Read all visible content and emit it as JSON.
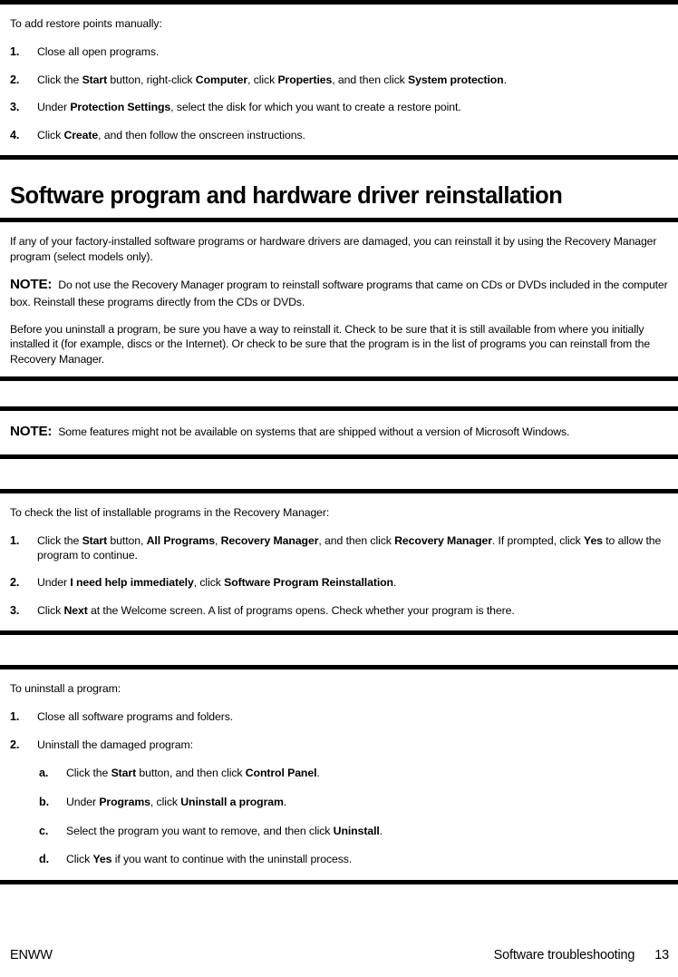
{
  "document": {
    "type": "printed-manual-page",
    "page_number": "13",
    "footer_left": "ENWW",
    "footer_chapter": "Software troubleshooting"
  },
  "section_restore_points": {
    "lead": "To add restore points manually:",
    "steps": [
      {
        "marker": "1.",
        "parts": [
          {
            "text": "Close all open programs.",
            "bold": false
          }
        ]
      },
      {
        "marker": "2.",
        "parts": [
          {
            "text": "Click the ",
            "bold": false
          },
          {
            "text": "Start",
            "bold": true
          },
          {
            "text": " button, right-click ",
            "bold": false
          },
          {
            "text": "Computer",
            "bold": true
          },
          {
            "text": ", click ",
            "bold": false
          },
          {
            "text": "Properties",
            "bold": true
          },
          {
            "text": ", and then click ",
            "bold": false
          },
          {
            "text": "System protection",
            "bold": true
          },
          {
            "text": ".",
            "bold": false
          }
        ]
      },
      {
        "marker": "3.",
        "parts": [
          {
            "text": "Under ",
            "bold": false
          },
          {
            "text": "Protection Settings",
            "bold": true
          },
          {
            "text": ", select the disk for which you want to create a restore point.",
            "bold": false
          }
        ]
      },
      {
        "marker": "4.",
        "parts": [
          {
            "text": "Click ",
            "bold": false
          },
          {
            "text": "Create",
            "bold": true
          },
          {
            "text": ", and then follow the onscreen instructions.",
            "bold": false
          }
        ]
      }
    ]
  },
  "heading": {
    "title": "Software program and hardware driver reinstallation"
  },
  "section_reinstallation": {
    "intro": "If any of your factory-installed software programs or hardware drivers are damaged, you can reinstall it by using the Recovery Manager program (select models only).",
    "note_label": "NOTE:",
    "note_text": "Do not use the Recovery Manager program to reinstall software programs that came on CDs or DVDs included in the computer box. Reinstall these programs directly from the CDs or DVDs.",
    "paragraph": "Before you uninstall a program, be sure you have a way to reinstall it. Check to be sure that it is still available from where you initially installed it (for example, discs or the Internet). Or check to be sure that the program is in the list of programs you can reinstall from the Recovery Manager."
  },
  "note_block_windows": {
    "note_label": "NOTE:",
    "note_text": "Some features might not be available on systems that are shipped without a version of Microsoft Windows."
  },
  "section_check_list": {
    "lead": "To check the list of installable programs in the Recovery Manager:",
    "steps": [
      {
        "marker": "1.",
        "parts": [
          {
            "text": "Click the ",
            "bold": false
          },
          {
            "text": "Start",
            "bold": true
          },
          {
            "text": " button, ",
            "bold": false
          },
          {
            "text": "All Programs",
            "bold": true
          },
          {
            "text": ", ",
            "bold": false
          },
          {
            "text": "Recovery Manager",
            "bold": true
          },
          {
            "text": ", and then click ",
            "bold": false
          },
          {
            "text": "Recovery Manager",
            "bold": true
          },
          {
            "text": ". If prompted, click ",
            "bold": false
          },
          {
            "text": "Yes",
            "bold": true
          },
          {
            "text": " to allow the program to continue.",
            "bold": false
          }
        ]
      },
      {
        "marker": "2.",
        "parts": [
          {
            "text": "Under ",
            "bold": false
          },
          {
            "text": "I need help immediately",
            "bold": true
          },
          {
            "text": ", click ",
            "bold": false
          },
          {
            "text": "Software Program Reinstallation",
            "bold": true
          },
          {
            "text": ".",
            "bold": false
          }
        ]
      },
      {
        "marker": "3.",
        "parts": [
          {
            "text": "Click ",
            "bold": false
          },
          {
            "text": "Next",
            "bold": true
          },
          {
            "text": " at the Welcome screen. A list of programs opens. Check whether your program is there.",
            "bold": false
          }
        ]
      }
    ]
  },
  "section_uninstall": {
    "lead": "To uninstall a program:",
    "steps": [
      {
        "marker": "1.",
        "parts": [
          {
            "text": "Close all software programs and folders.",
            "bold": false
          }
        ]
      },
      {
        "marker": "2.",
        "parts": [
          {
            "text": "Uninstall the damaged program:",
            "bold": false
          }
        ]
      }
    ],
    "substeps": [
      {
        "marker": "a.",
        "parts": [
          {
            "text": "Click the ",
            "bold": false
          },
          {
            "text": "Start",
            "bold": true
          },
          {
            "text": " button, and then click ",
            "bold": false
          },
          {
            "text": "Control Panel",
            "bold": true
          },
          {
            "text": ".",
            "bold": false
          }
        ]
      },
      {
        "marker": "b.",
        "parts": [
          {
            "text": "Under ",
            "bold": false
          },
          {
            "text": "Programs",
            "bold": true
          },
          {
            "text": ", click ",
            "bold": false
          },
          {
            "text": "Uninstall a program",
            "bold": true
          },
          {
            "text": ".",
            "bold": false
          }
        ]
      },
      {
        "marker": "c.",
        "parts": [
          {
            "text": "Select the program you want to remove, and then click ",
            "bold": false
          },
          {
            "text": "Uninstall",
            "bold": true
          },
          {
            "text": ".",
            "bold": false
          }
        ]
      },
      {
        "marker": "d.",
        "parts": [
          {
            "text": "Click ",
            "bold": false
          },
          {
            "text": "Yes",
            "bold": true
          },
          {
            "text": " if you want to continue with the uninstall process.",
            "bold": false
          }
        ]
      }
    ]
  },
  "colors": {
    "rule": "#000000",
    "text": "#000000",
    "background": "#ffffff"
  }
}
